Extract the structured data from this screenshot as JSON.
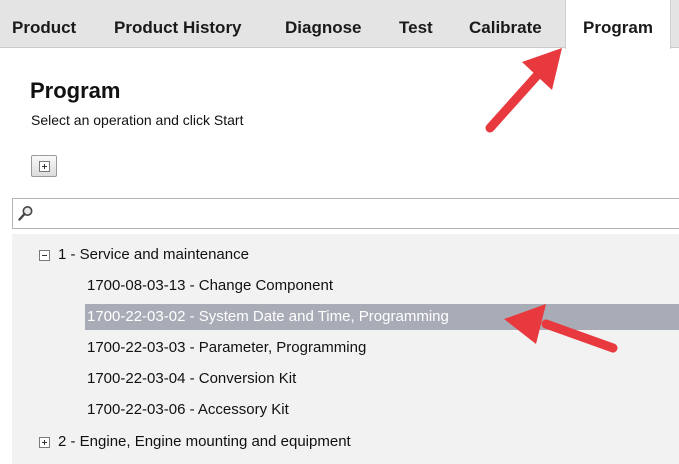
{
  "tabs": [
    {
      "label": "Product",
      "active": false
    },
    {
      "label": "Product History",
      "active": false
    },
    {
      "label": "Diagnose",
      "active": false
    },
    {
      "label": "Test",
      "active": false
    },
    {
      "label": "Calibrate",
      "active": false
    },
    {
      "label": "Program",
      "active": true
    }
  ],
  "page": {
    "title": "Program",
    "subtitle": "Select an operation and click Start"
  },
  "search": {
    "value": "",
    "icon": "magnifier-icon"
  },
  "tree": {
    "groups": [
      {
        "label": "1 - Service and maintenance",
        "expanded": true,
        "items": [
          {
            "label": "1700-08-03-13 - Change Component",
            "selected": false
          },
          {
            "label": "1700-22-03-02 - System Date and Time, Programming",
            "selected": true
          },
          {
            "label": "1700-22-03-03 - Parameter, Programming",
            "selected": false
          },
          {
            "label": "1700-22-03-04 - Conversion Kit",
            "selected": false
          },
          {
            "label": "1700-22-03-06 - Accessory Kit",
            "selected": false
          }
        ]
      },
      {
        "label": "2 - Engine, Engine mounting and equipment",
        "expanded": false,
        "items": []
      }
    ]
  },
  "colors": {
    "tabbar_bg": "#e4e4e4",
    "selected_row_bg": "#a8acb6",
    "tree_bg": "#f2f2f2",
    "annotation_arrow": "#e8393e"
  }
}
